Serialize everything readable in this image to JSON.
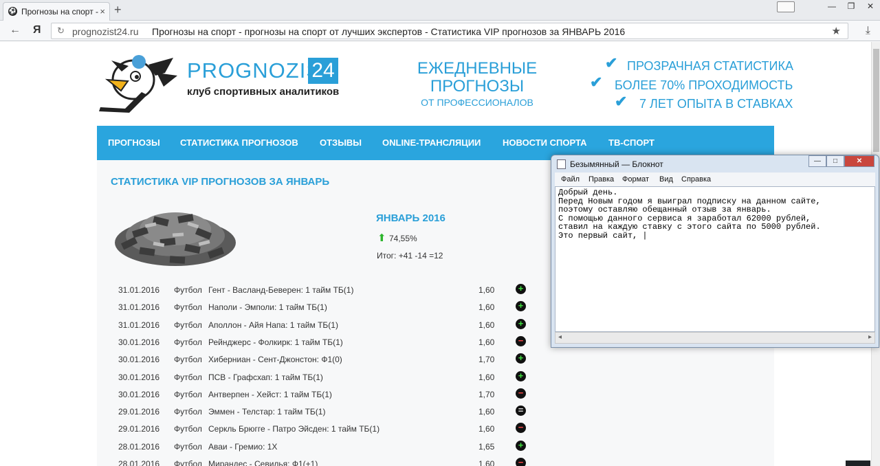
{
  "browser": {
    "tab_title": "Прогнозы на спорт - ",
    "tab_close": "×",
    "new_tab": "+",
    "url": "prognozist24.ru",
    "page_title": "Прогнозы на спорт - прогнозы на спорт от лучших экспертов - Статистика VIP прогнозов за ЯНВАРЬ 2016",
    "back_icon": "←",
    "yandex_icon": "Я",
    "refresh_icon": "↻",
    "star_icon": "★",
    "download_icon": "⤓",
    "win_min": "—",
    "win_max": "❐",
    "win_close": "✕"
  },
  "header": {
    "logo_text": "PROGNOZIST",
    "logo_num": "24",
    "logo_sub": "клуб спортивных аналитиков",
    "daily_line1": "ЕЖЕДНЕВНЫЕ",
    "daily_line2": "ПРОГНОЗЫ",
    "daily_line3": "ОТ ПРОФЕССИОНАЛОВ",
    "features": [
      "ПРОЗРАЧНАЯ СТАТИСТИКА",
      "БОЛЕЕ 70% ПРОХОДИМОСТЬ",
      "7 ЛЕТ ОПЫТА В СТАВКАХ"
    ],
    "check_glyph": "✔"
  },
  "menu": [
    "ПРОГНОЗЫ",
    "СТАТИСТИКА ПРОГНОЗОВ",
    "ОТЗЫВЫ",
    "ONLINE-ТРАНСЛЯЦИИ",
    "НОВОСТИ СПОРТА",
    "ТВ-СПОРТ"
  ],
  "stats": {
    "section_title": "СТАТИСТИКА VIP ПРОГНОЗОВ ЗА ЯНВАРЬ",
    "month": "ЯНВАРЬ 2016",
    "arrow": "⬆",
    "percent": "74,55%",
    "total": "Итог: +41 -14 =12",
    "rows": [
      {
        "date": "31.01.2016",
        "sport": "Футбол",
        "match": "Гент - Васланд-Беверен: 1 тайм ТБ(1)",
        "odds": "1,60",
        "result": "+",
        "cls": "win"
      },
      {
        "date": "31.01.2016",
        "sport": "Футбол",
        "match": "Наполи - Эмполи: 1 тайм ТБ(1)",
        "odds": "1,60",
        "result": "+",
        "cls": "win"
      },
      {
        "date": "31.01.2016",
        "sport": "Футбол",
        "match": "Аполлон - Айя Напа: 1 тайм ТБ(1)",
        "odds": "1,60",
        "result": "+",
        "cls": "win"
      },
      {
        "date": "30.01.2016",
        "sport": "Футбол",
        "match": "Рейнджерс - Фолкирк: 1 тайм ТБ(1)",
        "odds": "1,60",
        "result": "−",
        "cls": "loss"
      },
      {
        "date": "30.01.2016",
        "sport": "Футбол",
        "match": "Хиберниан - Сент-Джонстон: Ф1(0)",
        "odds": "1,70",
        "result": "+",
        "cls": "win"
      },
      {
        "date": "30.01.2016",
        "sport": "Футбол",
        "match": "ПСВ - Графсхап: 1 тайм ТБ(1)",
        "odds": "1,60",
        "result": "+",
        "cls": "win"
      },
      {
        "date": "30.01.2016",
        "sport": "Футбол",
        "match": "Антверпен - Хейст: 1 тайм ТБ(1)",
        "odds": "1,70",
        "result": "−",
        "cls": "loss"
      },
      {
        "date": "29.01.2016",
        "sport": "Футбол",
        "match": "Эммен - Телстар: 1 тайм ТБ(1)",
        "odds": "1,60",
        "result": "=",
        "cls": "ret"
      },
      {
        "date": "29.01.2016",
        "sport": "Футбол",
        "match": "Серкль Брюгге - Патро Эйсден: 1 тайм ТБ(1)",
        "odds": "1,60",
        "result": "−",
        "cls": "loss"
      },
      {
        "date": "28.01.2016",
        "sport": "Футбол",
        "match": "Аваи - Гремио: 1Х",
        "odds": "1,65",
        "result": "+",
        "cls": "win"
      },
      {
        "date": "28.01.2016",
        "sport": "Футбол",
        "match": "Мирандес - Севилья: Ф1(+1)",
        "odds": "1,60",
        "result": "−",
        "cls": "loss"
      }
    ]
  },
  "to_top": "︿",
  "notepad": {
    "title": "Безымянный — Блокнот",
    "menu": [
      "Файл",
      "Правка",
      "Формат",
      "Вид",
      "Справка"
    ],
    "text": "Добрый день.\nПеред Новым годом я выиграл подписку на данном сайте,\nпоэтому оставляю обещанный отзыв за январь.\nС помощью данного сервиса я заработал 62000 рублей,\nставил на каждую ставку с этого сайта по 5000 рублей.\nЭто первый сайт, |",
    "btn_min": "—",
    "btn_max": "□",
    "btn_close": "✕",
    "scroll_left": "◂",
    "scroll_right": "▸"
  }
}
